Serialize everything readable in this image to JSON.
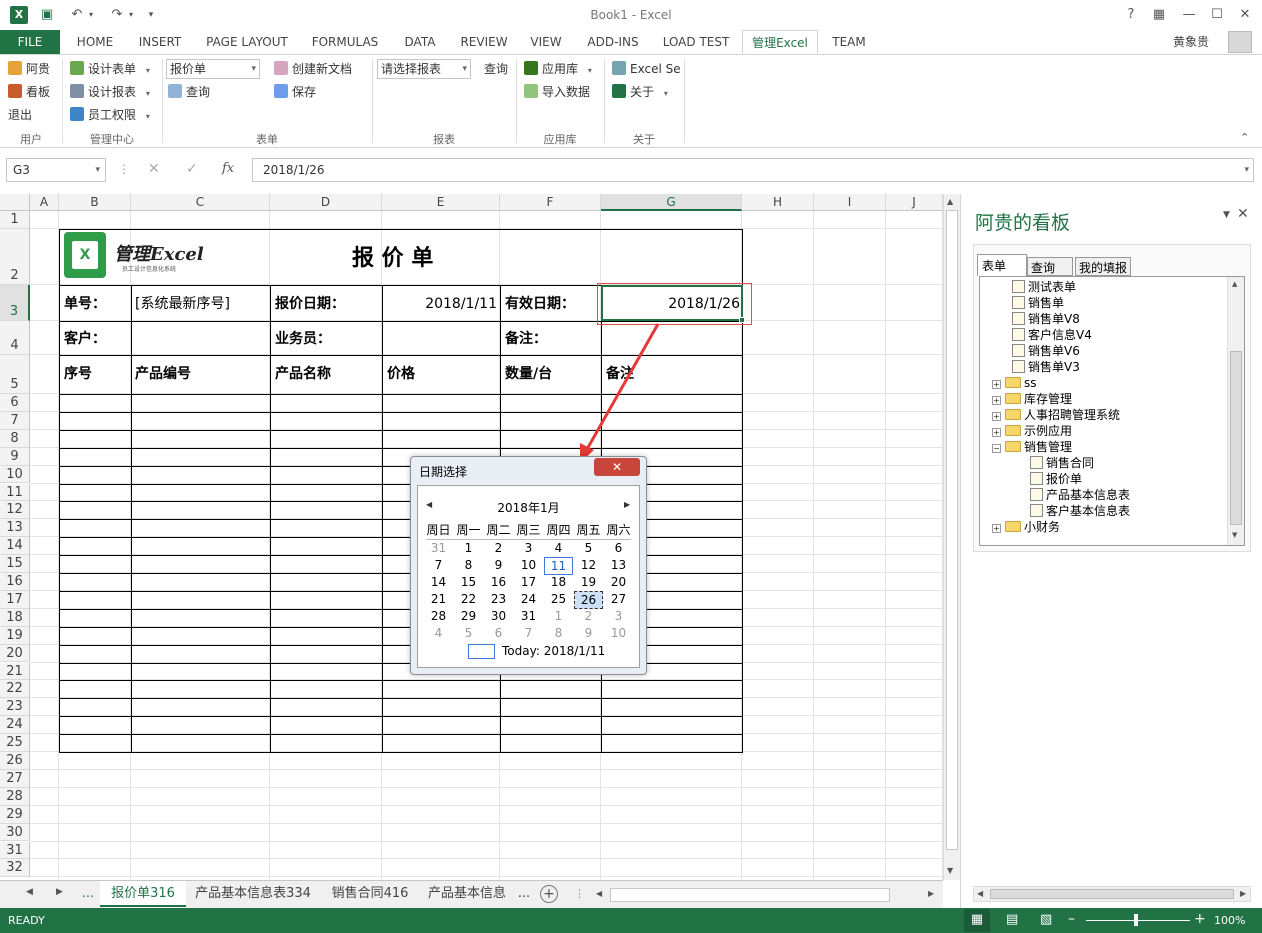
{
  "window": {
    "title": "Book1 - Excel",
    "user": "黄象贵"
  },
  "tabs": [
    "FILE",
    "HOME",
    "INSERT",
    "PAGE LAYOUT",
    "FORMULAS",
    "DATA",
    "REVIEW",
    "VIEW",
    "ADD-INS",
    "LOAD TEST",
    "管理Excel",
    "TEAM"
  ],
  "ribbon": {
    "user_group": {
      "label": "用户",
      "items": [
        "阿贵",
        "看板",
        "退出"
      ]
    },
    "mgmt_group": {
      "label": "管理中心",
      "items": [
        "设计表单",
        "设计报表",
        "员工权限"
      ]
    },
    "form_group": {
      "label": "表单",
      "dropdown": "报价单",
      "query": "查询",
      "create": "创建新文档",
      "save": "保存"
    },
    "report_group": {
      "label": "报表",
      "dropdown": "请选择报表",
      "query": "查询"
    },
    "app_group": {
      "label": "应用库",
      "items": [
        "应用库",
        "导入数据"
      ]
    },
    "about_group": {
      "label": "关于",
      "items": [
        "Excel Se",
        "关于"
      ]
    }
  },
  "formula_bar": {
    "name_box": "G3",
    "value": "2018/1/26",
    "fx": "fx"
  },
  "columns": [
    "A",
    "B",
    "C",
    "D",
    "E",
    "F",
    "G",
    "H",
    "I",
    "J"
  ],
  "rows": [
    "1",
    "2",
    "3",
    "4",
    "5",
    "6",
    "7",
    "8",
    "9",
    "10",
    "11",
    "12",
    "13",
    "14",
    "15",
    "16",
    "17",
    "18",
    "19",
    "20",
    "21",
    "22",
    "23",
    "24",
    "25",
    "26",
    "27",
    "28",
    "29",
    "30",
    "31",
    "32"
  ],
  "sheet": {
    "logo_text": "管理Excel",
    "logo_sub": "员工设计信息化系统",
    "title": "报 价 单",
    "labels": {
      "no": "单号：",
      "no_value": "[系统最新序号]",
      "quote_date": "报价日期：",
      "quote_date_value": "2018/1/11",
      "valid_date": "有效日期：",
      "valid_date_value": "2018/1/26",
      "customer": "客户：",
      "salesman": "业务员：",
      "remark": "备注："
    },
    "table_headers": [
      "序号",
      "产品编号",
      "产品名称",
      "价格",
      "数量/台",
      "备注"
    ]
  },
  "sheet_tabs": [
    "...",
    "报价单316",
    "产品基本信息表334",
    "销售合同416",
    "产品基本信息",
    "..."
  ],
  "status": {
    "ready": "READY",
    "zoom": "100%"
  },
  "panel": {
    "title": "阿贵的看板",
    "tabs": [
      "表单",
      "查询",
      "我的填报"
    ],
    "tree": [
      {
        "label": "测试表单",
        "type": "doc",
        "level": 1
      },
      {
        "label": "销售单",
        "type": "doc",
        "level": 1
      },
      {
        "label": "销售单V8",
        "type": "doc",
        "level": 1
      },
      {
        "label": "客户信息V4",
        "type": "doc",
        "level": 1
      },
      {
        "label": "销售单V6",
        "type": "doc",
        "level": 1
      },
      {
        "label": "销售单V3",
        "type": "doc",
        "level": 1
      },
      {
        "label": "ss",
        "type": "folder",
        "level": 0
      },
      {
        "label": "库存管理",
        "type": "folder",
        "level": 0
      },
      {
        "label": "人事招聘管理系统",
        "type": "folder",
        "level": 0
      },
      {
        "label": "示例应用",
        "type": "folder",
        "level": 0
      },
      {
        "label": "销售管理",
        "type": "folder-open",
        "level": 0
      },
      {
        "label": "销售合同",
        "type": "doc",
        "level": 2
      },
      {
        "label": "报价单",
        "type": "doc",
        "level": 2
      },
      {
        "label": "产品基本信息表",
        "type": "doc",
        "level": 2
      },
      {
        "label": "客户基本信息表",
        "type": "doc",
        "level": 2
      },
      {
        "label": "小财务",
        "type": "folder",
        "level": 0
      }
    ]
  },
  "date_dialog": {
    "title": "日期选择",
    "month": "2018年1月",
    "weekdays": [
      "周日",
      "周一",
      "周二",
      "周三",
      "周四",
      "周五",
      "周六"
    ],
    "weeks": [
      [
        "31",
        "1",
        "2",
        "3",
        "4",
        "5",
        "6"
      ],
      [
        "7",
        "8",
        "9",
        "10",
        "11",
        "12",
        "13"
      ],
      [
        "14",
        "15",
        "16",
        "17",
        "18",
        "19",
        "20"
      ],
      [
        "21",
        "22",
        "23",
        "24",
        "25",
        "26",
        "27"
      ],
      [
        "28",
        "29",
        "30",
        "31",
        "1",
        "2",
        "3"
      ],
      [
        "4",
        "5",
        "6",
        "7",
        "8",
        "9",
        "10"
      ]
    ],
    "today": "Today: 2018/1/11"
  }
}
